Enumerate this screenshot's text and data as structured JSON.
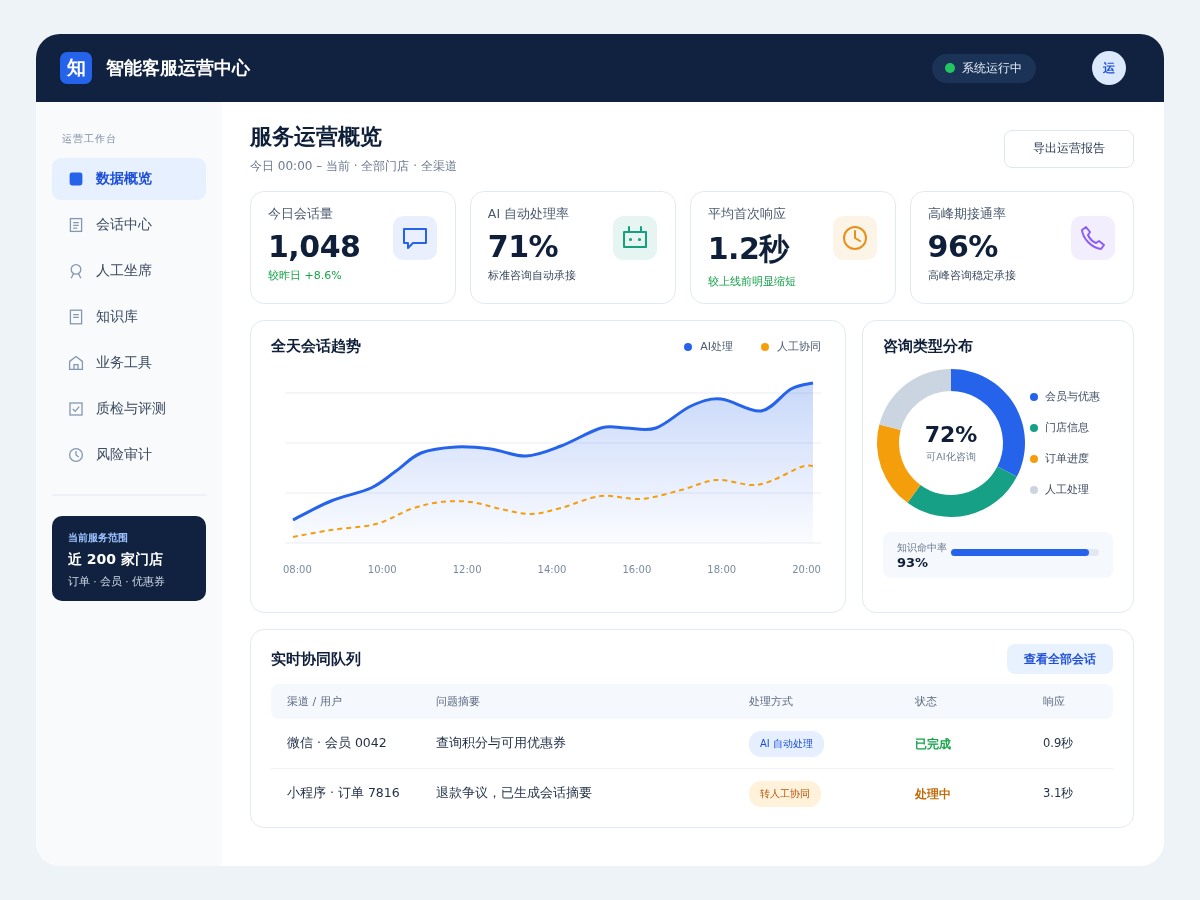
{
  "header": {
    "logo": "知",
    "title": "智能客服运营中心",
    "status": {
      "label": "系统运行中",
      "online": true
    },
    "avatar": "运"
  },
  "sidebar": {
    "section": "运营工作台",
    "items": [
      {
        "label": "数据概览",
        "selected": true
      },
      {
        "label": "会话中心",
        "selected": false
      },
      {
        "label": "人工坐席",
        "selected": false
      },
      {
        "label": "知识库",
        "selected": false
      },
      {
        "label": "业务工具",
        "selected": false
      },
      {
        "label": "质检与评测",
        "selected": false
      },
      {
        "label": "风险审计",
        "selected": false
      }
    ],
    "scope": {
      "caption": "当前服务范围",
      "title": "近 200 家门店",
      "detail": "订单 · 会员 · 优惠券"
    }
  },
  "page": {
    "title": "服务运营概览",
    "subtitle": "今日 00:00 – 当前 · 全部门店 · 全渠道",
    "export_button": "导出运营报告"
  },
  "stats": [
    {
      "label": "今日会话量",
      "value": "1,048",
      "note": "较昨日 +8.6%",
      "highlight": true,
      "color": "#2563eb"
    },
    {
      "label": "AI 自动处理率",
      "value": "71%",
      "note": "标准咨询自动承接",
      "highlight": false,
      "color": "#16a07f"
    },
    {
      "label": "平均首次响应",
      "value": "1.2秒",
      "note": "较上线前明显缩短",
      "highlight": true,
      "color": "#e8901a"
    },
    {
      "label": "高峰期接通率",
      "value": "96%",
      "note": "高峰咨询稳定承接",
      "highlight": false,
      "color": "#8b5cf6"
    }
  ],
  "trend": {
    "title": "全天会话趋势",
    "legend": [
      {
        "label": "AI处理",
        "color": "#2563eb"
      },
      {
        "label": "人工协同",
        "color": "#f59e0b"
      }
    ],
    "x_labels": [
      "08:00",
      "10:00",
      "12:00",
      "14:00",
      "16:00",
      "18:00",
      "20:00"
    ]
  },
  "distribution": {
    "title": "咨询类型分布",
    "center_value": "72%",
    "center_label": "可AI化咨询",
    "legend": [
      {
        "label": "会员与优惠",
        "color": "#2563eb"
      },
      {
        "label": "门店信息",
        "color": "#16a085"
      },
      {
        "label": "订单进度",
        "color": "#f59e0b"
      },
      {
        "label": "人工处理",
        "color": "#cbd5e1"
      }
    ],
    "hit_rate": {
      "label": "知识命中率",
      "value": "93%",
      "level": 0.93
    }
  },
  "queue": {
    "title": "实时协同队列",
    "view_all": "查看全部会话",
    "columns": [
      "渠道 / 用户",
      "问题摘要",
      "处理方式",
      "状态",
      "响应"
    ],
    "rows": [
      {
        "user": "微信 · 会员 0042",
        "summary": "查询积分与可用优惠券",
        "mode": {
          "label": "AI 自动处理",
          "kind": "ai"
        },
        "status": {
          "label": "已完成",
          "kind": "done"
        },
        "response": "0.9秒"
      },
      {
        "user": "小程序 · 订单 7816",
        "summary": "退款争议，已生成会话摘要",
        "mode": {
          "label": "转人工协同",
          "kind": "human"
        },
        "status": {
          "label": "处理中",
          "kind": "pending"
        },
        "response": "3.1秒"
      }
    ]
  }
}
